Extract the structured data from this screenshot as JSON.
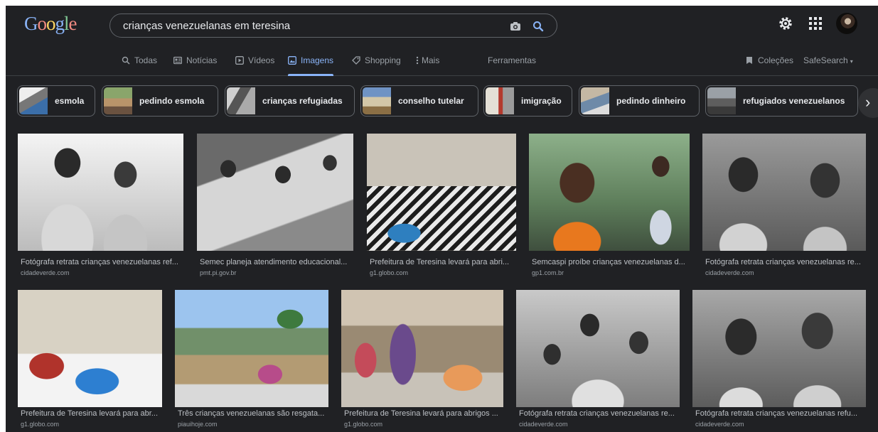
{
  "search": {
    "logo": [
      "G",
      "o",
      "o",
      "g",
      "l",
      "e"
    ],
    "query": "crianças venezuelanas em teresina"
  },
  "nav": {
    "items": [
      "Todas",
      "Notícias",
      "Vídeos",
      "Imagens",
      "Shopping",
      "Mais"
    ],
    "tools": "Ferramentas",
    "collections": "Coleções",
    "safesearch": "SafeSearch"
  },
  "chips": [
    "esmola",
    "pedindo esmola",
    "crianças refugiadas",
    "conselho tutelar",
    "imigração",
    "pedindo dinheiro",
    "refugiados venezuelanos"
  ],
  "results": [
    {
      "title": "Fotógrafa retrata crianças venezuelanas ref...",
      "source": "cidadeverde.com"
    },
    {
      "title": "Semec planeja atendimento educacional...",
      "source": "pmt.pi.gov.br"
    },
    {
      "title": "Prefeitura de Teresina levará para abri...",
      "source": "g1.globo.com"
    },
    {
      "title": "Semcaspi proíbe crianças venezuelanas d...",
      "source": "gp1.com.br"
    },
    {
      "title": "Fotógrafa retrata crianças venezuelanas re...",
      "source": "cidadeverde.com"
    },
    {
      "title": "Prefeitura de Teresina levará para abr...",
      "source": "g1.globo.com"
    },
    {
      "title": "Três crianças venezuelanas são resgata...",
      "source": "piauihoje.com"
    },
    {
      "title": "Prefeitura de Teresina levará para abrigos ...",
      "source": "g1.globo.com"
    },
    {
      "title": "Fotógrafa retrata crianças venezuelanas re...",
      "source": "cidadeverde.com"
    },
    {
      "title": "Fotógrafa retrata crianças venezuelanas refu...",
      "source": "cidadeverde.com"
    }
  ],
  "colors": {
    "background": "#202124",
    "accent": "#8ab4f8",
    "text": "#e8eaed"
  },
  "icons": [
    "camera-icon",
    "search-icon",
    "gear-icon",
    "apps-icon",
    "avatar",
    "chevron-right-icon"
  ]
}
